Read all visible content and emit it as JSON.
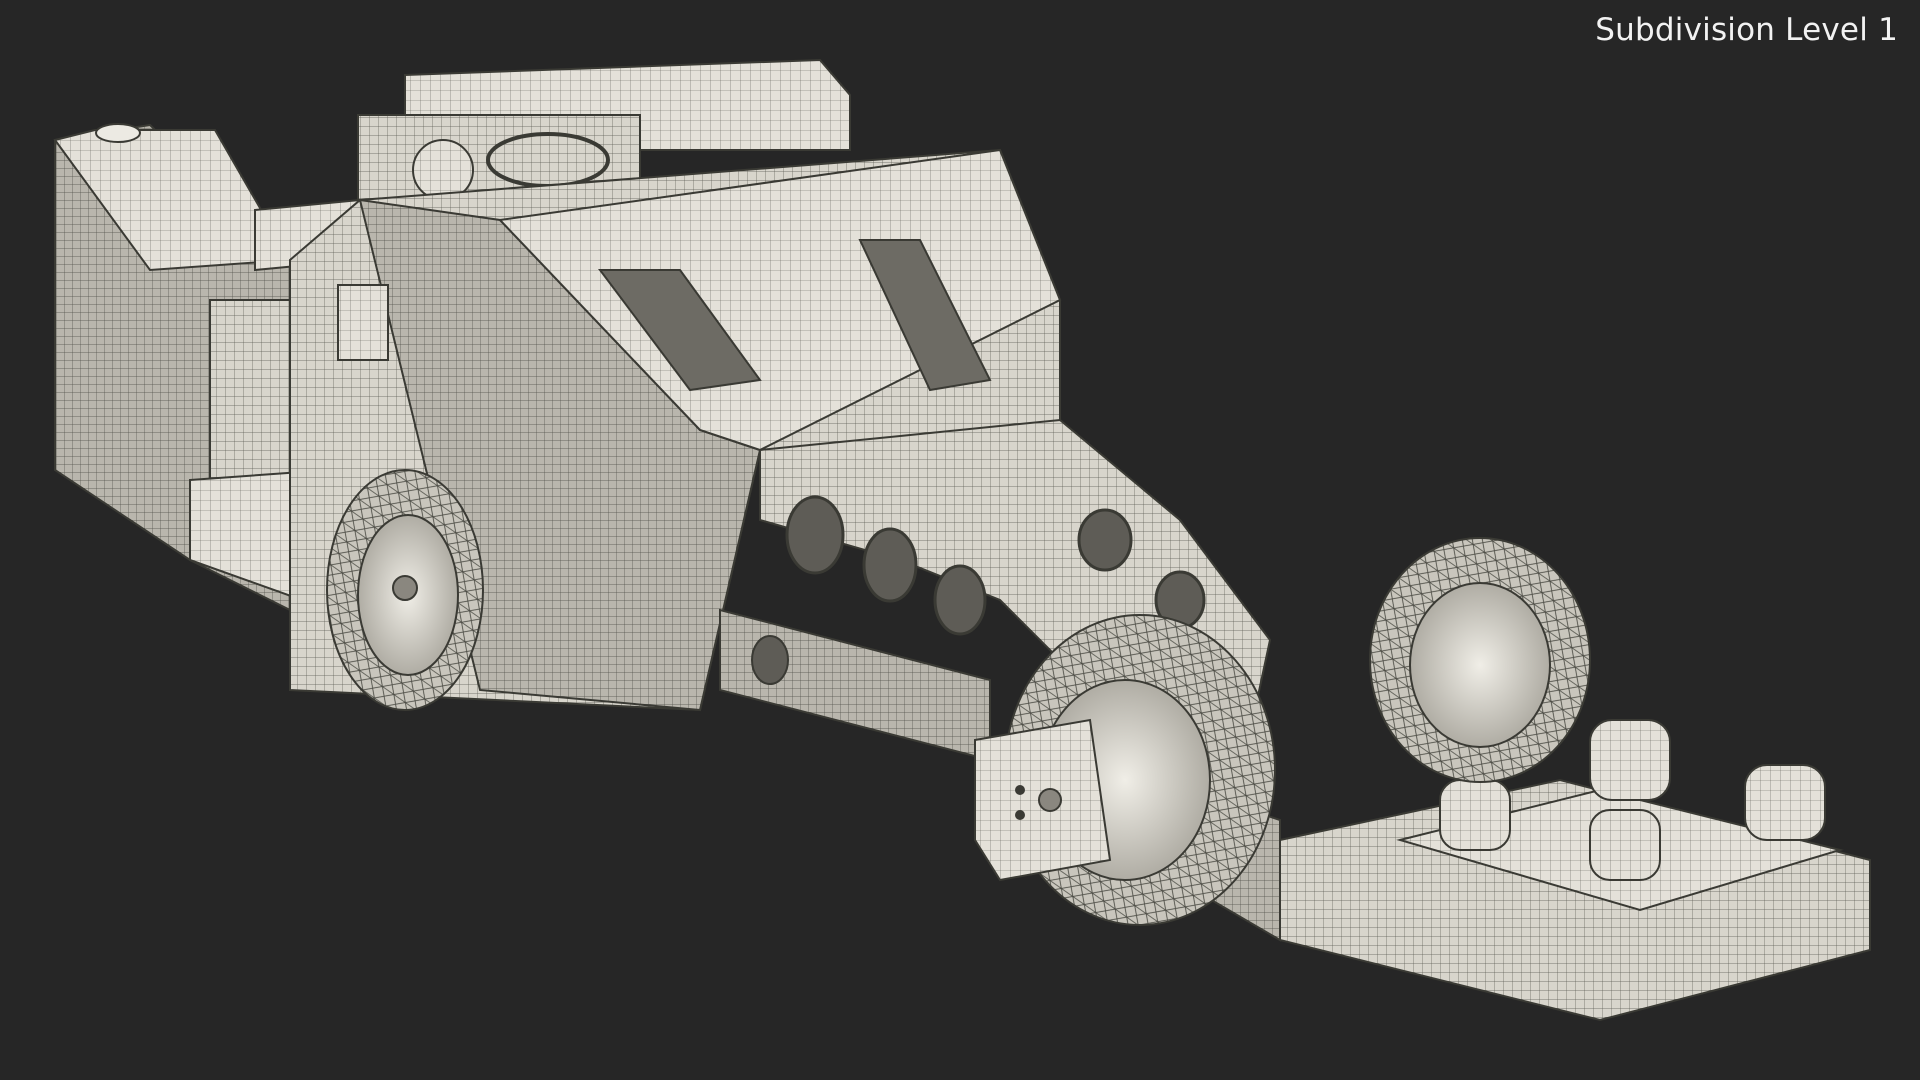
{
  "viewport": {
    "label": "Subdivision Level 1",
    "background": "#262626"
  },
  "model": {
    "material": "wireframe over white clay",
    "mesh_color": "#d6d3c9",
    "wire_color": "#4a4a42"
  }
}
